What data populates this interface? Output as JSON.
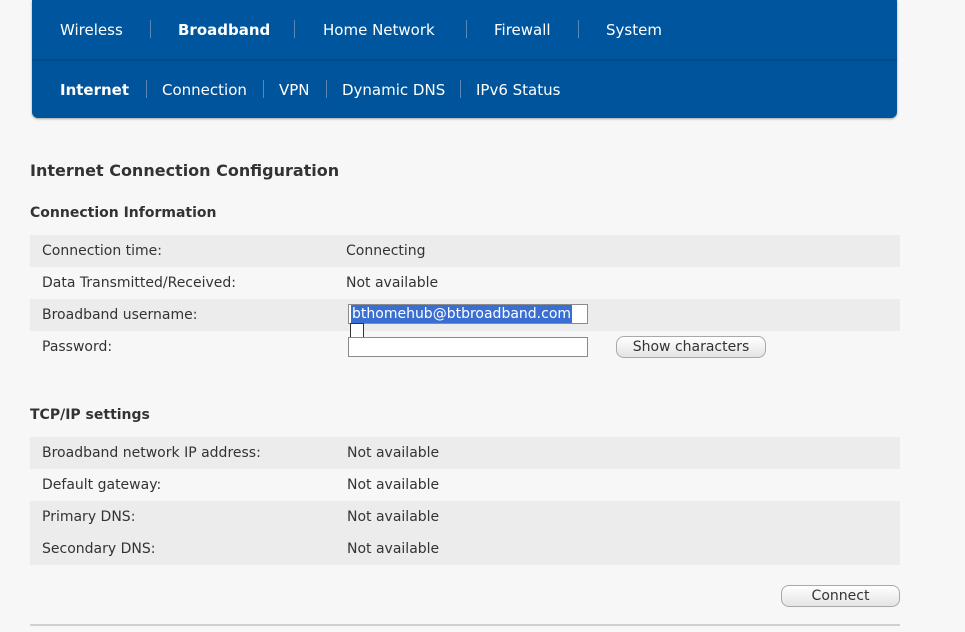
{
  "nav": {
    "main": [
      {
        "label": "Wireless",
        "active": false
      },
      {
        "label": "Broadband",
        "active": true
      },
      {
        "label": "Home Network",
        "active": false
      },
      {
        "label": "Firewall",
        "active": false
      },
      {
        "label": "System",
        "active": false
      }
    ],
    "sub": [
      {
        "label": "Internet",
        "active": true
      },
      {
        "label": "Connection",
        "active": false
      },
      {
        "label": "VPN",
        "active": false
      },
      {
        "label": "Dynamic DNS",
        "active": false
      },
      {
        "label": "IPv6 Status",
        "active": false
      }
    ]
  },
  "page": {
    "title": "Internet Connection Configuration"
  },
  "connection_info": {
    "heading": "Connection Information",
    "connection_time_label": "Connection time:",
    "connection_time_value": "Connecting",
    "data_label": "Data Transmitted/Received:",
    "data_value": "Not available",
    "username_label": "Broadband username:",
    "username_value": "bthomehub@btbroadband.com",
    "password_label": "Password:",
    "password_value": "",
    "show_chars_label": "Show characters"
  },
  "tcpip": {
    "heading": "TCP/IP settings",
    "rows": [
      {
        "label": "Broadband network IP address:",
        "value": "Not available"
      },
      {
        "label": "Default gateway:",
        "value": "Not available"
      },
      {
        "label": "Primary DNS:",
        "value": "Not available"
      },
      {
        "label": "Secondary DNS:",
        "value": "Not available"
      }
    ]
  },
  "actions": {
    "connect_label": "Connect"
  },
  "colors": {
    "nav_bg": "#00549b",
    "selection": "#3a6fd1"
  }
}
